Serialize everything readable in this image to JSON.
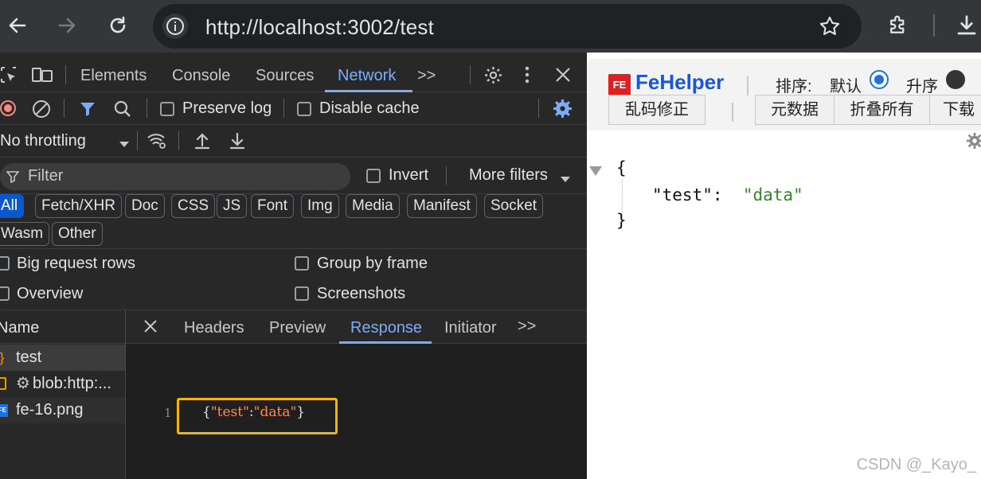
{
  "browser": {
    "url": "http://localhost:3002/test"
  },
  "devtools": {
    "tabs": [
      "Elements",
      "Console",
      "Sources",
      "Network",
      ">>"
    ],
    "network": {
      "preserve_log": "Preserve log",
      "disable_cache": "Disable cache",
      "throttling": "No throttling",
      "filter_placeholder": "Filter",
      "invert": "Invert",
      "more_filters": "More filters",
      "type_chips": [
        "All",
        "Fetch/XHR",
        "Doc",
        "CSS",
        "JS",
        "Font",
        "Img",
        "Media",
        "Manifest",
        "Socket",
        "Wasm",
        "Other"
      ],
      "options": {
        "big_request_rows": "Big request rows",
        "group_by_frame": "Group by frame",
        "overview": "Overview",
        "screenshots": "Screenshots"
      },
      "name_header": "Name",
      "requests": [
        {
          "icon": "{}",
          "name": "test"
        },
        {
          "icon": "⚙",
          "name": "blob:http:..."
        },
        {
          "icon": "FE",
          "name": "fe-16.png"
        }
      ],
      "detail_tabs": [
        "Headers",
        "Preview",
        "Response",
        "Initiator",
        ">>"
      ],
      "response": {
        "line_number": "1",
        "brace_open": "{",
        "key": "\"test\"",
        "colon": ":",
        "value": "\"data\"",
        "brace_close": "}"
      }
    }
  },
  "fehelper": {
    "logo_text": "FeHelper",
    "logo_badge": "FE",
    "sort_label": "排序:",
    "sort_default": "默认",
    "sort_asc": "升序",
    "fix_button": "乱码修正",
    "meta_button": "元数据",
    "fold_button": "折叠所有",
    "download_button": "下载",
    "json": {
      "open": "{",
      "key": "\"test\"",
      "colon": ":",
      "value": "\"data\"",
      "close": "}"
    }
  },
  "watermark": "CSDN @_Kayo_",
  "colors": {
    "accent": "#7cacf8",
    "highlight_border": "#f5b800",
    "json_string": "#2e8b22",
    "response_key": "#ff8a5b"
  }
}
